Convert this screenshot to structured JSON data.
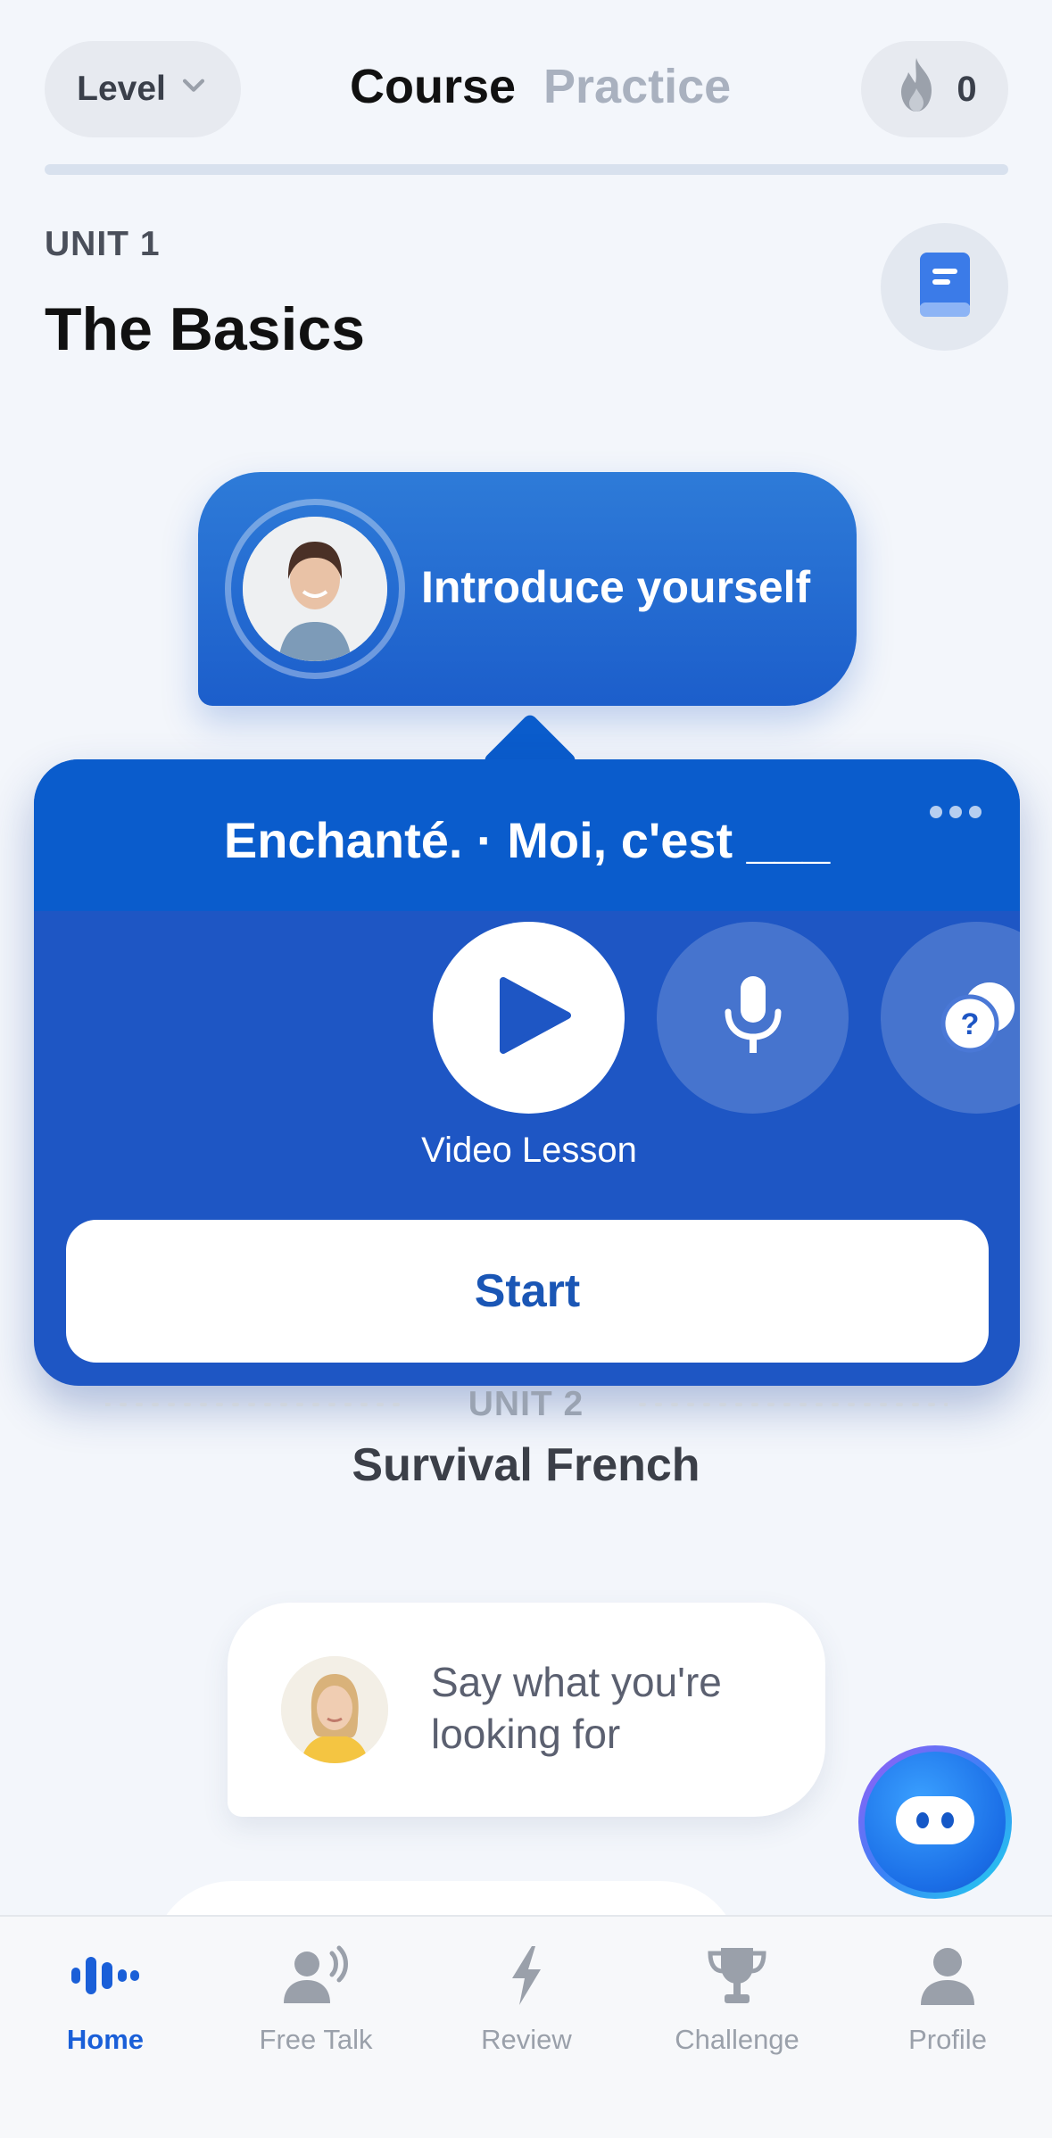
{
  "header": {
    "level_label": "Level",
    "tabs": [
      {
        "label": "Course",
        "active": true
      },
      {
        "label": "Practice",
        "active": false
      }
    ],
    "streak_count": "0"
  },
  "unit1": {
    "label": "UNIT 1",
    "title": "The Basics"
  },
  "lesson_node": {
    "title": "Introduce yourself"
  },
  "popup": {
    "title": "Enchanté. · Moi, c'est ___",
    "mode_label": "Video Lesson",
    "start_label": "Start",
    "modes": [
      "play-icon",
      "microphone-icon",
      "question-chat-icon"
    ]
  },
  "unit2": {
    "label": "UNIT 2",
    "title": "Survival French"
  },
  "lesson_card2": {
    "text": "Say what you're looking for"
  },
  "bottom_nav": {
    "items": [
      {
        "label": "Home",
        "icon": "soundwave-icon",
        "active": true
      },
      {
        "label": "Free Talk",
        "icon": "speaking-person-icon",
        "active": false
      },
      {
        "label": "Review",
        "icon": "lightning-icon",
        "active": false
      },
      {
        "label": "Challenge",
        "icon": "trophy-icon",
        "active": false
      },
      {
        "label": "Profile",
        "icon": "person-icon",
        "active": false
      }
    ]
  },
  "colors": {
    "primary_blue": "#1e56c4",
    "active_nav": "#1a5fd8",
    "background": "#f3f6fb"
  }
}
